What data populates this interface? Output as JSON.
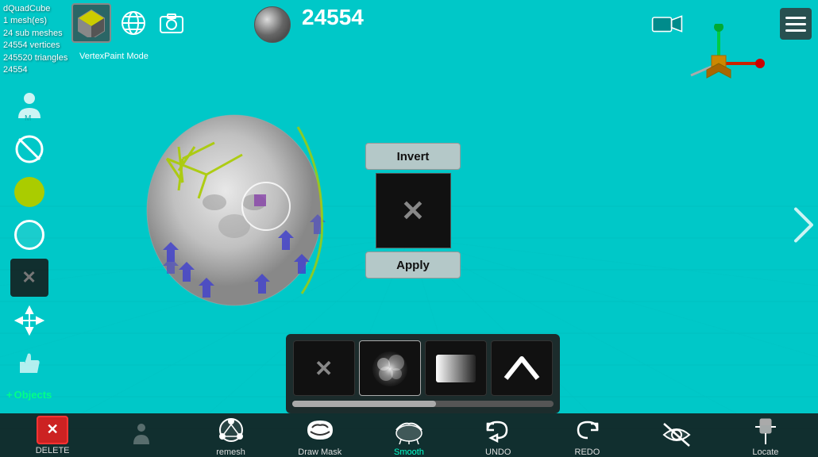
{
  "app": {
    "title": "dQuadCube",
    "mesh_count": "1 mesh(es)",
    "sub_meshes": "24 sub meshes",
    "vertices": "24554 vertices",
    "triangles": "245520 triangles",
    "vertex_id": "24554",
    "vertex_count_display": "24554",
    "vertex_paint_label": "VertexPaint  Mode"
  },
  "toolbar": {
    "invert_label": "Invert",
    "apply_label": "Apply"
  },
  "bottom_tools": [
    {
      "id": "delete",
      "label": "DELETE",
      "icon": "✕"
    },
    {
      "id": "remesh",
      "label": "remesh",
      "icon": "⬡"
    },
    {
      "id": "draw-mask",
      "label": "Draw Mask",
      "icon": "🎭"
    },
    {
      "id": "smooth",
      "label": "Smooth",
      "icon": "〜"
    },
    {
      "id": "undo",
      "label": "UNDO",
      "icon": "↩"
    },
    {
      "id": "redo",
      "label": "REDO",
      "icon": "↪"
    },
    {
      "id": "hide",
      "label": "",
      "icon": "👁"
    },
    {
      "id": "locate",
      "label": "Locate",
      "icon": "📍"
    }
  ],
  "brush_types": [
    {
      "id": "x-brush",
      "label": "X"
    },
    {
      "id": "cloud-brush",
      "label": "cloud"
    },
    {
      "id": "gradient-brush",
      "label": "gradient"
    },
    {
      "id": "up-brush",
      "label": "chevron"
    }
  ],
  "slider": {
    "value": 55
  },
  "gizmo": {
    "visible": true
  }
}
